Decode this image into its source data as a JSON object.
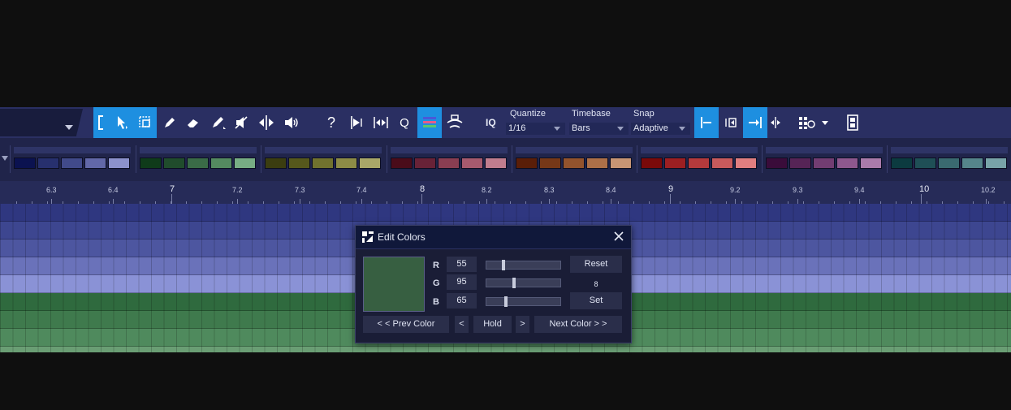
{
  "toolbar": {
    "quantize": {
      "label": "Quantize",
      "value": "1/16"
    },
    "timebase": {
      "label": "Timebase",
      "value": "Bars"
    },
    "snap": {
      "label": "Snap",
      "value": "Adaptive"
    },
    "iq_label": "IQ",
    "quantize_tool": "Q",
    "help": "?",
    "icons": [
      "range-icon",
      "arrow-icon",
      "select-box-icon",
      "pencil-icon",
      "eraser-icon",
      "paint-icon",
      "mute-icon",
      "split-icon",
      "speaker-icon",
      "help-icon",
      "bend-icon",
      "stretch-icon",
      "quantize-icon",
      "color-lanes-icon",
      "listen-icon",
      "snap-start-icon",
      "snap-frame-icon",
      "snap-end-icon",
      "snap-cursor-icon",
      "grid-options-icon",
      "film-icon"
    ],
    "accent": "#1e8fe0"
  },
  "palette": {
    "groups": [
      [
        "#0b1250",
        "#27306e",
        "#414a8a",
        "#6268a8",
        "#8c92cc"
      ],
      [
        "#0f3b1a",
        "#204c2c",
        "#3a6b47",
        "#548a60",
        "#77ad84"
      ],
      [
        "#3b3d10",
        "#56581c",
        "#71722e",
        "#8d8c46",
        "#a9a768"
      ],
      [
        "#4a0c1a",
        "#682237",
        "#8a3e52",
        "#a65a6e",
        "#c07d8e"
      ],
      [
        "#5a1e08",
        "#763818",
        "#93532d",
        "#ad7048",
        "#c79574"
      ],
      [
        "#7a0a0a",
        "#9c1f22",
        "#b43a3c",
        "#c85a5c",
        "#e07e80"
      ],
      [
        "#3a0c3a",
        "#562456",
        "#723d72",
        "#8e588e",
        "#aa7baa"
      ],
      [
        "#0c3b40",
        "#1f4f56",
        "#3a6a70",
        "#55858b",
        "#78a3a8"
      ]
    ]
  },
  "ruler": {
    "ticks": [
      {
        "label": "6.3",
        "major": false
      },
      {
        "label": "6.4",
        "major": false
      },
      {
        "label": "7",
        "major": true
      },
      {
        "label": "7.2",
        "major": false
      },
      {
        "label": "7.3",
        "major": false
      },
      {
        "label": "7.4",
        "major": false
      },
      {
        "label": "8",
        "major": true
      },
      {
        "label": "8.2",
        "major": false
      },
      {
        "label": "8.3",
        "major": false
      },
      {
        "label": "8.4",
        "major": false
      },
      {
        "label": "9",
        "major": true
      },
      {
        "label": "9.2",
        "major": false
      },
      {
        "label": "9.3",
        "major": false
      },
      {
        "label": "9.4",
        "major": false
      },
      {
        "label": "10",
        "major": true
      },
      {
        "label": "10.2",
        "major": false
      }
    ]
  },
  "lanes": [
    "#2f3780",
    "#3d4690",
    "#4d56a0",
    "#6a72ba",
    "#8a92d6",
    "#2f6a3e",
    "#3f7a4d",
    "#4f8a5d",
    "#6a9e74"
  ],
  "dialog": {
    "title": "Edit Colors",
    "preview_color": "#375f41",
    "channels": [
      {
        "label": "R",
        "value": "55",
        "fraction": 0.216
      },
      {
        "label": "G",
        "value": "95",
        "fraction": 0.373
      },
      {
        "label": "B",
        "value": "65",
        "fraction": 0.255
      }
    ],
    "reset": "Reset",
    "number": "8",
    "set": "Set",
    "prev": "< <   Prev Color",
    "lt": "<",
    "hold": "Hold",
    "gt": ">",
    "next": "Next Color   > >"
  }
}
